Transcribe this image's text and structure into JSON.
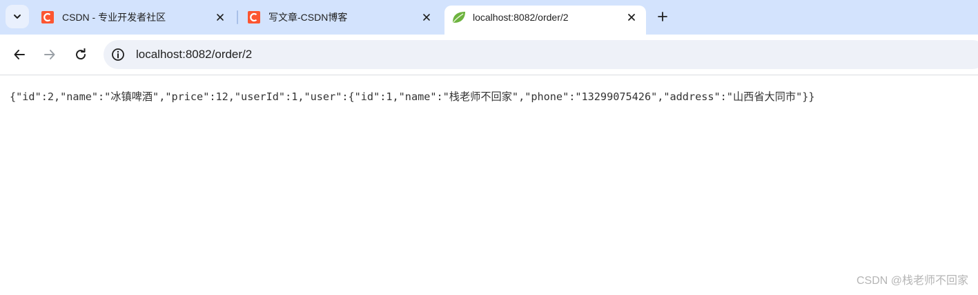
{
  "colors": {
    "tabstrip_bg": "#d3e3fd",
    "csdn_red": "#fc5531",
    "spring_green": "#6db33f",
    "omnibox_bg": "#eef1f8"
  },
  "tabs": [
    {
      "title": "CSDN - 专业开发者社区",
      "favicon": "csdn-icon",
      "active": false
    },
    {
      "title": "写文章-CSDN博客",
      "favicon": "csdn-icon",
      "active": false
    },
    {
      "title": "localhost:8082/order/2",
      "favicon": "spring-leaf-icon",
      "active": true
    }
  ],
  "omnibox": {
    "url": "localhost:8082/order/2"
  },
  "content": {
    "json_text": "{\"id\":2,\"name\":\"冰镇啤酒\",\"price\":12,\"userId\":1,\"user\":{\"id\":1,\"name\":\"栈老师不回家\",\"phone\":\"13299075426\",\"address\":\"山西省大同市\"}}"
  },
  "watermark": "CSDN @栈老师不回家"
}
